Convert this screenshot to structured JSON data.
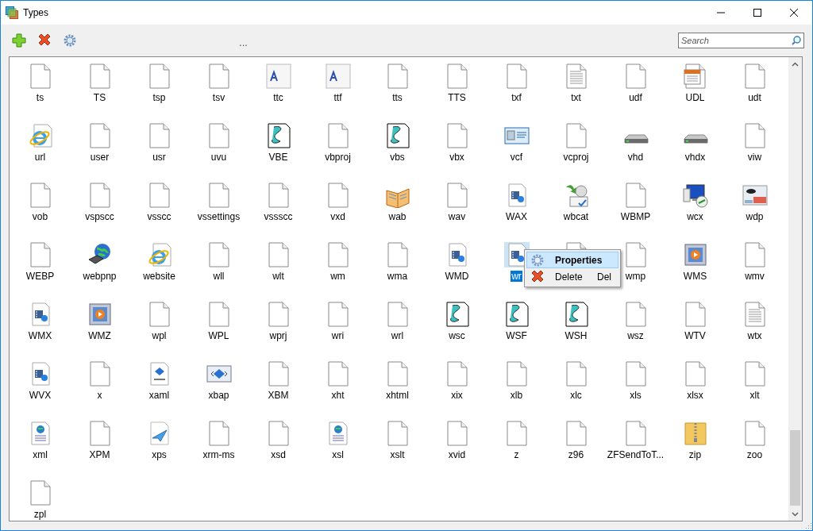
{
  "window": {
    "title": "Types"
  },
  "toolbar": {
    "grip": "..."
  },
  "search": {
    "placeholder": "Search"
  },
  "items": [
    {
      "label": "ts",
      "kind": "doc",
      "selected": false
    },
    {
      "label": "TS",
      "kind": "doc",
      "selected": false
    },
    {
      "label": "tsp",
      "kind": "doc",
      "selected": false
    },
    {
      "label": "tsv",
      "kind": "doc",
      "selected": false
    },
    {
      "label": "ttc",
      "kind": "font",
      "selected": false
    },
    {
      "label": "ttf",
      "kind": "font",
      "selected": false
    },
    {
      "label": "tts",
      "kind": "doc",
      "selected": false
    },
    {
      "label": "TTS",
      "kind": "doc",
      "selected": false
    },
    {
      "label": "txf",
      "kind": "doc",
      "selected": false
    },
    {
      "label": "txt",
      "kind": "text",
      "selected": false
    },
    {
      "label": "udf",
      "kind": "doc",
      "selected": false
    },
    {
      "label": "UDL",
      "kind": "calendar",
      "selected": false
    },
    {
      "label": "udt",
      "kind": "doc",
      "selected": false
    },
    {
      "label": "url",
      "kind": "web",
      "selected": false
    },
    {
      "label": "user",
      "kind": "doc",
      "selected": false
    },
    {
      "label": "usr",
      "kind": "doc",
      "selected": false
    },
    {
      "label": "uvu",
      "kind": "doc",
      "selected": false
    },
    {
      "label": "VBE",
      "kind": "script",
      "selected": false
    },
    {
      "label": "vbproj",
      "kind": "doc",
      "selected": false
    },
    {
      "label": "vbs",
      "kind": "script",
      "selected": false
    },
    {
      "label": "vbx",
      "kind": "doc",
      "selected": false
    },
    {
      "label": "vcf",
      "kind": "card",
      "selected": false
    },
    {
      "label": "vcproj",
      "kind": "doc",
      "selected": false
    },
    {
      "label": "vhd",
      "kind": "drive",
      "selected": false
    },
    {
      "label": "vhdx",
      "kind": "drive",
      "selected": false
    },
    {
      "label": "viw",
      "kind": "doc",
      "selected": false
    },
    {
      "label": "vob",
      "kind": "doc",
      "selected": false
    },
    {
      "label": "vspscc",
      "kind": "doc",
      "selected": false
    },
    {
      "label": "vsscc",
      "kind": "doc",
      "selected": false
    },
    {
      "label": "vssettings",
      "kind": "doc",
      "selected": false
    },
    {
      "label": "vssscc",
      "kind": "doc",
      "selected": false
    },
    {
      "label": "vxd",
      "kind": "doc",
      "selected": false
    },
    {
      "label": "wab",
      "kind": "book",
      "selected": false
    },
    {
      "label": "wav",
      "kind": "doc",
      "selected": false
    },
    {
      "label": "WAX",
      "kind": "media",
      "selected": false
    },
    {
      "label": "wbcat",
      "kind": "sync",
      "selected": false
    },
    {
      "label": "WBMP",
      "kind": "doc",
      "selected": false
    },
    {
      "label": "wcx",
      "kind": "remote",
      "selected": false
    },
    {
      "label": "wdp",
      "kind": "image",
      "selected": false
    },
    {
      "label": "WEBP",
      "kind": "doc",
      "selected": false
    },
    {
      "label": "webpnp",
      "kind": "globe",
      "selected": false
    },
    {
      "label": "website",
      "kind": "web",
      "selected": false
    },
    {
      "label": "wll",
      "kind": "doc",
      "selected": false
    },
    {
      "label": "wlt",
      "kind": "doc",
      "selected": false
    },
    {
      "label": "wm",
      "kind": "doc",
      "selected": false
    },
    {
      "label": "wma",
      "kind": "doc",
      "selected": false
    },
    {
      "label": "WMD",
      "kind": "media",
      "selected": false
    },
    {
      "label": "wr",
      "kind": "media",
      "selected": true
    },
    {
      "kind": "doc",
      "selected": false
    },
    {
      "label": "wmp",
      "kind": "doc",
      "selected": false
    },
    {
      "label": "WMS",
      "kind": "play",
      "selected": false
    },
    {
      "label": "wmv",
      "kind": "doc",
      "selected": false
    },
    {
      "label": "WMX",
      "kind": "media",
      "selected": false
    },
    {
      "label": "WMZ",
      "kind": "play",
      "selected": false
    },
    {
      "label": "wpl",
      "kind": "doc",
      "selected": false
    },
    {
      "label": "WPL",
      "kind": "doc",
      "selected": false
    },
    {
      "label": "wprj",
      "kind": "doc",
      "selected": false
    },
    {
      "label": "wri",
      "kind": "doc",
      "selected": false
    },
    {
      "label": "wrl",
      "kind": "doc",
      "selected": false
    },
    {
      "label": "wsc",
      "kind": "script",
      "selected": false
    },
    {
      "label": "WSF",
      "kind": "script",
      "selected": false
    },
    {
      "label": "WSH",
      "kind": "script",
      "selected": false
    },
    {
      "label": "wsz",
      "kind": "doc",
      "selected": false
    },
    {
      "label": "WTV",
      "kind": "doc",
      "selected": false
    },
    {
      "label": "wtx",
      "kind": "text",
      "selected": false
    },
    {
      "label": "WVX",
      "kind": "media",
      "selected": false
    },
    {
      "label": "x",
      "kind": "doc",
      "selected": false
    },
    {
      "label": "xaml",
      "kind": "xaml",
      "selected": false
    },
    {
      "label": "xbap",
      "kind": "xbap",
      "selected": false
    },
    {
      "label": "XBM",
      "kind": "doc",
      "selected": false
    },
    {
      "label": "xht",
      "kind": "doc",
      "selected": false
    },
    {
      "label": "xhtml",
      "kind": "doc",
      "selected": false
    },
    {
      "label": "xix",
      "kind": "doc",
      "selected": false
    },
    {
      "label": "xlb",
      "kind": "doc",
      "selected": false
    },
    {
      "label": "xlc",
      "kind": "doc",
      "selected": false
    },
    {
      "label": "xls",
      "kind": "doc",
      "selected": false
    },
    {
      "label": "xlsx",
      "kind": "doc",
      "selected": false
    },
    {
      "label": "xlt",
      "kind": "doc",
      "selected": false
    },
    {
      "label": "xml",
      "kind": "xml",
      "selected": false
    },
    {
      "label": "XPM",
      "kind": "doc",
      "selected": false
    },
    {
      "label": "xps",
      "kind": "xps",
      "selected": false
    },
    {
      "label": "xrm-ms",
      "kind": "doc",
      "selected": false
    },
    {
      "label": "xsd",
      "kind": "doc",
      "selected": false
    },
    {
      "label": "xsl",
      "kind": "xml",
      "selected": false
    },
    {
      "label": "xslt",
      "kind": "doc",
      "selected": false
    },
    {
      "label": "xvid",
      "kind": "doc",
      "selected": false
    },
    {
      "label": "z",
      "kind": "doc",
      "selected": false
    },
    {
      "label": "z96",
      "kind": "doc",
      "selected": false
    },
    {
      "label": "ZFSendToT...",
      "kind": "doc",
      "selected": false
    },
    {
      "label": "zip",
      "kind": "zip",
      "selected": false
    },
    {
      "label": "zoo",
      "kind": "doc",
      "selected": false
    },
    {
      "label": "zpl",
      "kind": "doc",
      "selected": false
    }
  ],
  "context_menu": [
    {
      "label": "Properties",
      "kind": "properties",
      "selected": true
    },
    {
      "label": "Delete",
      "shortcut": "Del",
      "kind": "delete",
      "selected": false
    }
  ]
}
